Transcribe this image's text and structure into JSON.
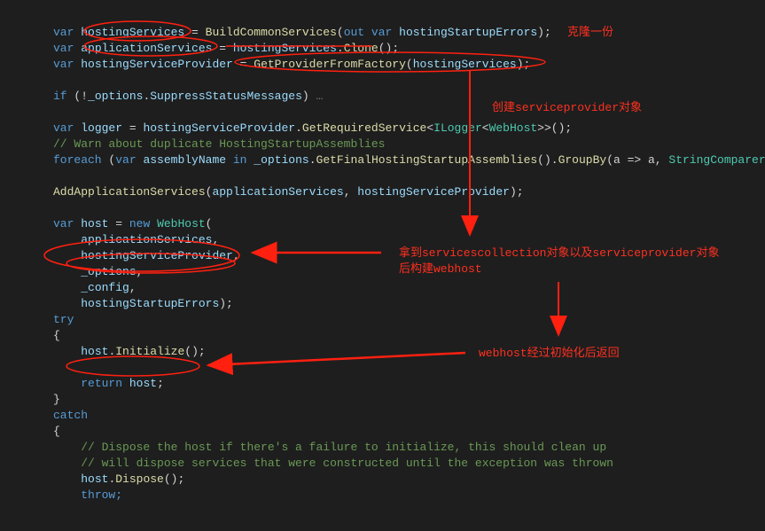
{
  "code": {
    "l1_var": "var",
    "l1_hosting": "hostingServices",
    "l1_eq": " = ",
    "l1_build": "BuildCommonServices",
    "l1_out": "out",
    "l1_vark": "var",
    "l1_err": "hostingStartupErrors",
    "l1_end": ");",
    "l2_var": "var",
    "l2_app": "applicationServices",
    "l2_eq": " = ",
    "l2_hs": "hostingServices",
    "l2_dot": ".",
    "l2_clone": "Clone",
    "l2_end": "();",
    "l3_var": "var",
    "l3_hsp": "hostingServiceProvider",
    "l3_eq": " = ",
    "l3_get": "GetProviderFromFactory",
    "l3_open": "(",
    "l3_arg": "hostingServices",
    "l3_end": ");",
    "l5_if": "if",
    "l5_open": " (!",
    "l5_opt": "_options",
    "l5_dot": ".",
    "l5_supp": "SuppressStatusMessages",
    "l5_close": ")",
    "l5_dots": " …",
    "l7_var": "var",
    "l7_logger": "logger",
    "l7_eq": " = ",
    "l7_hsp": "hostingServiceProvider",
    "l7_dot": ".",
    "l7_req": "GetRequiredService",
    "l7_lt": "<",
    "l7_il": "ILogger",
    "l7_lt2": "<",
    "l7_wh": "WebHost",
    "l7_gt": ">>();",
    "l8_comment": "// Warn about duplicate HostingStartupAssemblies",
    "l9_foreach": "foreach",
    "l9_open": " (",
    "l9_var": "var",
    "l9_an": "assemblyName",
    "l9_in": "in",
    "l9_opt": "_options",
    "l9_dot": ".",
    "l9_get": "GetFinalHostingStartupAssemblies",
    "l9_p": "().",
    "l9_gb": "GroupBy",
    "l9_arg": "(a => a, ",
    "l9_sc": "StringComparer",
    "l9_end": ".",
    "l11_add": "AddApplicationServices",
    "l11_open": "(",
    "l11_app": "applicationServices",
    "l11_comma": ", ",
    "l11_hsp": "hostingServiceProvider",
    "l11_end": ");",
    "l13_var": "var",
    "l13_host": "host",
    "l13_eq": " = ",
    "l13_new": "new",
    "l13_wh": "WebHost",
    "l13_open": "(",
    "l14_app": "applicationServices",
    "l14_c": ",",
    "l15_hsp": "hostingServiceProvider",
    "l15_c": ",",
    "l16_opt": "_options",
    "l16_c": ",",
    "l17_cfg": "_config",
    "l17_c": ",",
    "l18_err": "hostingStartupErrors",
    "l18_end": ");",
    "l19_try": "try",
    "l20_brace": "{",
    "l21_host": "host",
    "l21_dot": ".",
    "l21_init": "Initialize",
    "l21_end": "();",
    "l23_return": "return",
    "l23_host": "host",
    "l23_end": ";",
    "l24_brace": "}",
    "l25_catch": "catch",
    "l26_brace": "{",
    "l27_comment": "// Dispose the host if there's a failure to initialize, this should clean up",
    "l28_comment": "// will dispose services that were constructed until the exception was thrown",
    "l29_host": "host",
    "l29_dot": ".",
    "l29_disp": "Dispose",
    "l29_end": "();",
    "l30_throw": "throw;"
  },
  "annotations": {
    "a1": "克隆一份",
    "a2": "创建serviceprovider对象",
    "a3": "拿到servicescollection对象以及serviceprovider对象\n后构建webhost",
    "a4": "webhost经过初始化后返回"
  }
}
